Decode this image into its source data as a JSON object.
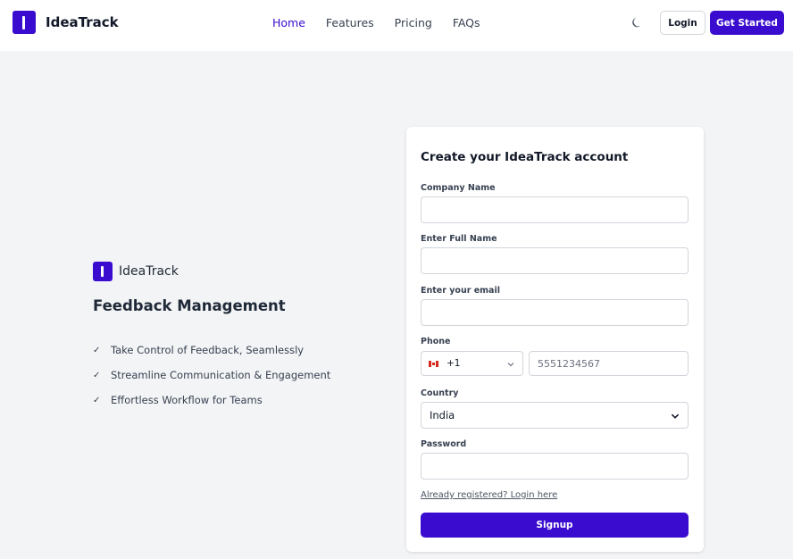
{
  "header": {
    "brand": "IdeaTrack",
    "nav": [
      {
        "label": "Home",
        "active": true
      },
      {
        "label": "Features",
        "active": false
      },
      {
        "label": "Pricing",
        "active": false
      },
      {
        "label": "FAQs",
        "active": false
      }
    ],
    "theme_icon": "moon-icon",
    "login_label": "Login",
    "get_started_label": "Get Started"
  },
  "hero": {
    "brand": "IdeaTrack",
    "headline": "Feedback Management",
    "features": [
      "Take Control of Feedback, Seamlessly",
      "Streamline Communication & Engagement",
      "Effortless Workflow for Teams"
    ]
  },
  "form": {
    "title": "Create your IdeaTrack account",
    "company_label": "Company Name",
    "company_value": "",
    "name_label": "Enter Full Name",
    "name_value": "",
    "email_label": "Enter your email",
    "email_value": "",
    "phone_label": "Phone",
    "country_code": "+1",
    "country_code_flag": "canada-flag-icon",
    "phone_placeholder": "5551234567",
    "country_label": "Country",
    "country_value": "India",
    "password_label": "Password",
    "password_value": "",
    "login_link": "Already registered? Login here",
    "signup_label": "Signup"
  },
  "colors": {
    "brand": "#3a0ccf",
    "background": "#f3f4f6"
  }
}
